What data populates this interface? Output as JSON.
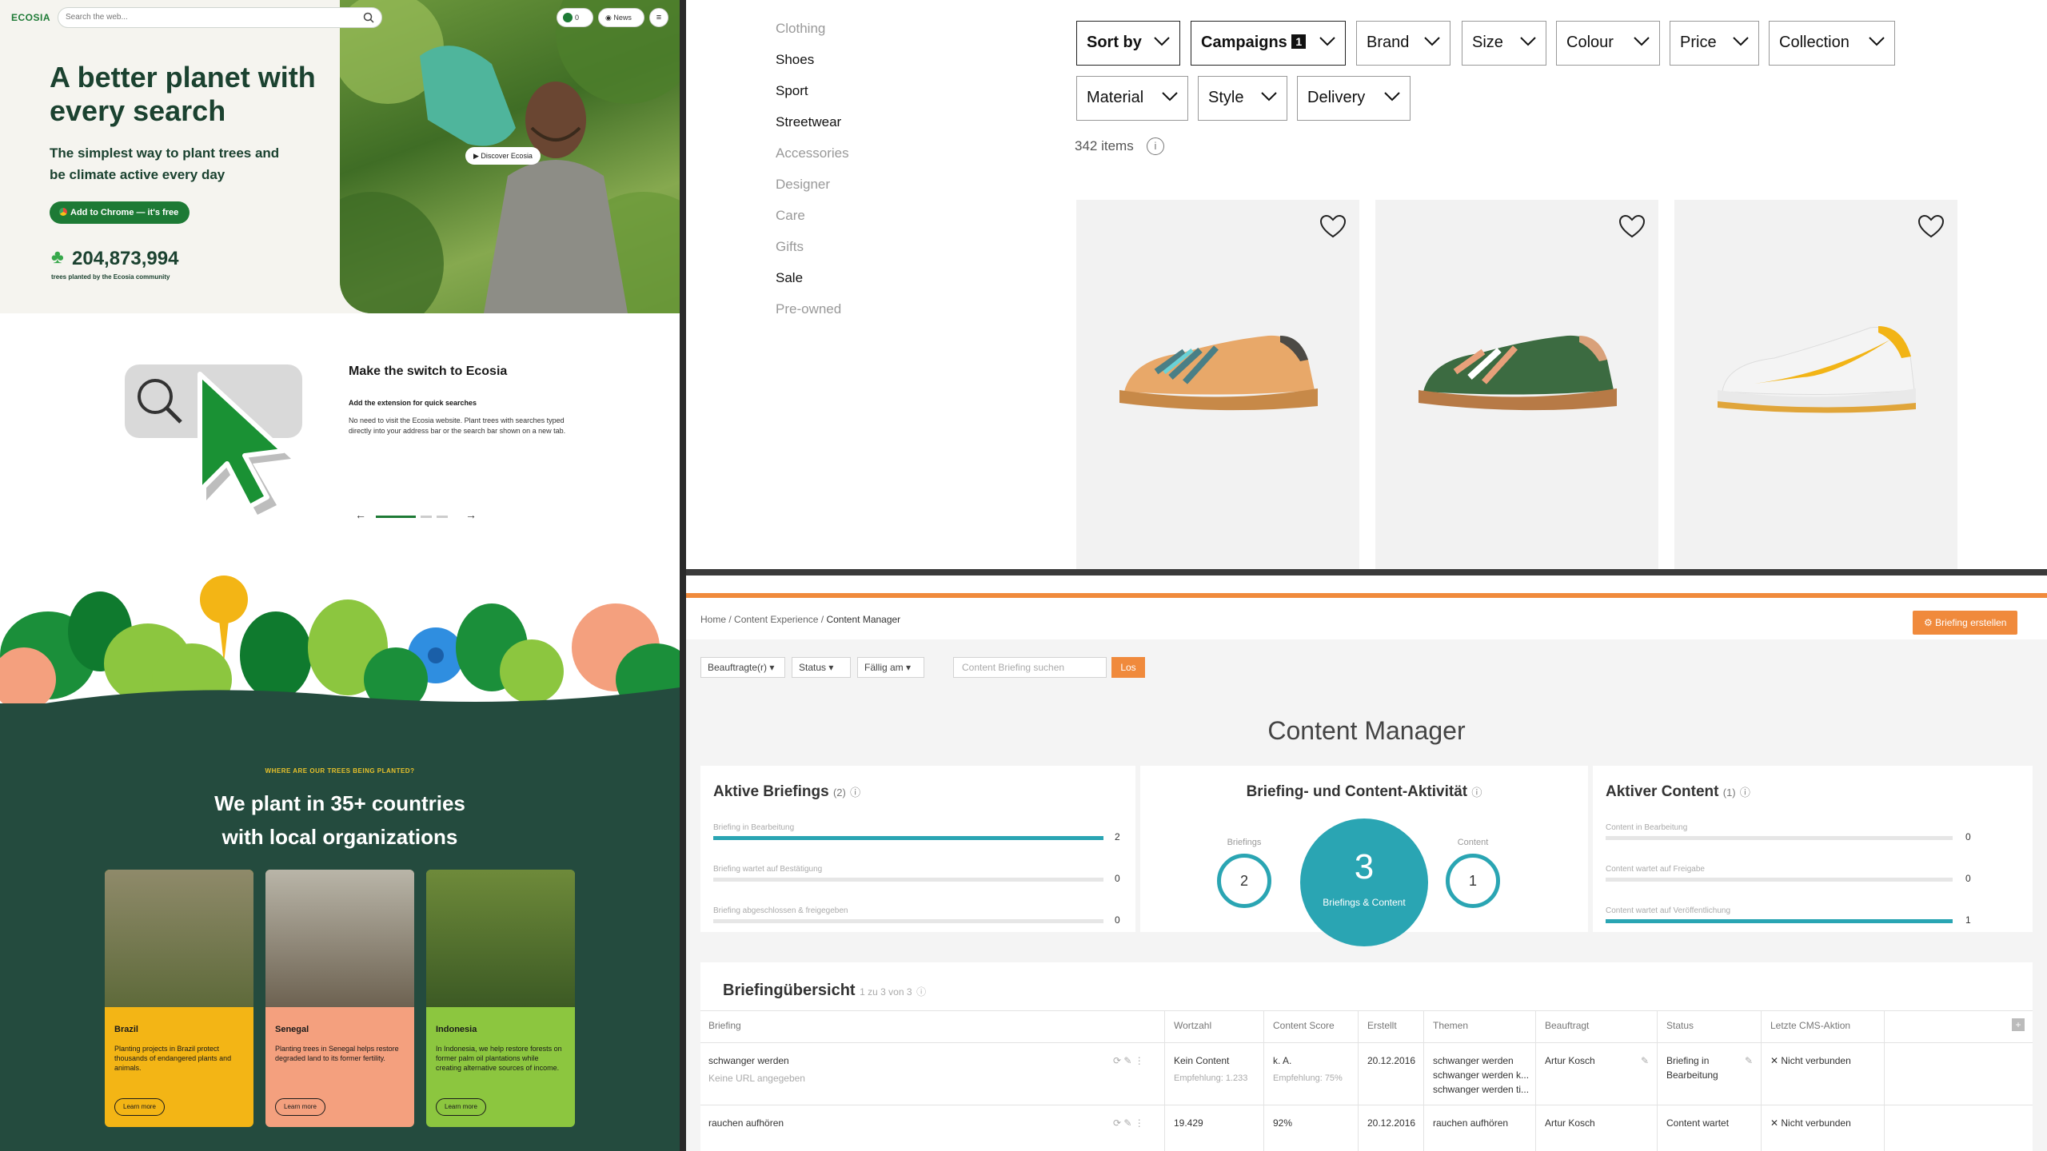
{
  "ecosia": {
    "logo": "ECOSIA",
    "search_placeholder": "Search the web...",
    "tree_counter_badge": "0",
    "news_label": "News",
    "menu_glyph": "≡",
    "headline": "A better planet with every search",
    "subheadline": "The simplest way to plant trees and be climate active every day",
    "cta_label": "Add to Chrome — it's free",
    "tree_count": "204,873,994",
    "tree_count_label": "trees planted by the Ecosia community",
    "discover_label": "▶ Discover Ecosia",
    "switch_title": "Make the switch to Ecosia",
    "switch_subtitle": "Add the extension for quick searches",
    "switch_body": "No need to visit the Ecosia website. Plant trees with searches typed directly into your address bar or the search bar shown on a new tab.",
    "carousel_prev": "←",
    "carousel_next": "→",
    "where_label": "WHERE ARE OUR TREES BEING PLANTED?",
    "countries_headline_1": "We plant in 35+ countries",
    "countries_headline_2": "with local organizations",
    "cards": [
      {
        "name": "Brazil",
        "text": "Planting projects in Brazil protect thousands of endangered plants and animals.",
        "button": "Learn more",
        "color": "#f3b515"
      },
      {
        "name": "Senegal",
        "text": "Planting trees in Senegal helps restore degraded land to its former fertility.",
        "button": "Learn more",
        "color": "#f4a07e"
      },
      {
        "name": "Indonesia",
        "text": "In Indonesia, we help restore forests on former palm oil plantations while creating alternative sources of income.",
        "button": "Learn more",
        "color": "#8cc63f"
      }
    ],
    "colors": {
      "brand_green": "#1d7a35",
      "dark_green": "#244b3e",
      "headline": "#1b4230"
    }
  },
  "shop": {
    "categories": [
      {
        "label": "Clothing",
        "active": false
      },
      {
        "label": "Shoes",
        "active": true
      },
      {
        "label": "Sport",
        "active": true
      },
      {
        "label": "Streetwear",
        "active": true
      },
      {
        "label": "Accessories",
        "active": false
      },
      {
        "label": "Designer",
        "active": false
      },
      {
        "label": "Care",
        "active": false
      },
      {
        "label": "Gifts",
        "active": false
      },
      {
        "label": "Sale",
        "active": true
      },
      {
        "label": "Pre-owned",
        "active": false
      }
    ],
    "filters": {
      "sort": "Sort by",
      "campaigns": "Campaigns",
      "campaigns_count": "1",
      "brand": "Brand",
      "size": "Size",
      "colour": "Colour",
      "price": "Price",
      "collection": "Collection",
      "material": "Material",
      "style": "Style",
      "delivery": "Delivery"
    },
    "item_count": "342 items",
    "info_glyph": "i",
    "products": [
      {
        "icon": "sneaker-orange-image"
      },
      {
        "icon": "sneaker-green-image"
      },
      {
        "icon": "sneaker-white-yellow-image"
      }
    ]
  },
  "cms": {
    "breadcrumb": [
      "Home",
      "Content Experience",
      "Content Manager"
    ],
    "new_briefing": "Briefing erstellen",
    "filter_assignee": "Beauftragte(r)",
    "filter_status": "Status",
    "filter_due": "Fällig am",
    "search_placeholder": "Content Briefing suchen",
    "search_button": "Los",
    "title": "Content Manager",
    "active_briefings": {
      "title": "Aktive Briefings",
      "count": "(2)",
      "bars": [
        {
          "label": "Briefing in Bearbeitung",
          "value": 2,
          "fill": 1.0
        },
        {
          "label": "Briefing wartet auf Bestätigung",
          "value": 0,
          "fill": 0
        },
        {
          "label": "Briefing abgeschlossen & freigegeben",
          "value": 0,
          "fill": 0
        }
      ]
    },
    "activity": {
      "title": "Briefing- und Content-Aktivität",
      "briefings_label": "Briefings",
      "briefings_value": "2",
      "total_value": "3",
      "total_label": "Briefings & Content",
      "content_label": "Content",
      "content_value": "1"
    },
    "active_content": {
      "title": "Aktiver Content",
      "count": "(1)",
      "bars": [
        {
          "label": "Content in Bearbeitung",
          "value": 0,
          "fill": 0
        },
        {
          "label": "Content wartet auf Freigabe",
          "value": 0,
          "fill": 0
        },
        {
          "label": "Content wartet auf Veröffentlichung",
          "value": 1,
          "fill": 1.0
        }
      ]
    },
    "overview": {
      "title": "Briefingübersicht",
      "subtitle": "1 zu 3 von 3",
      "columns": [
        "Briefing",
        "Wortzahl",
        "Content Score",
        "Erstellt",
        "Themen",
        "Beauftragt",
        "Status",
        "Letzte CMS-Aktion"
      ],
      "rows": [
        {
          "briefing": "schwanger werden",
          "url": "Keine URL angegeben",
          "words": "Kein Content",
          "words_hint": "Empfehlung: 1.233",
          "score": "k. A.",
          "score_hint": "Empfehlung: 75%",
          "created": "20.12.2016",
          "topics": [
            "schwanger werden",
            "schwanger werden k...",
            "schwanger werden ti..."
          ],
          "assignee": "Artur Kosch",
          "status": [
            "Briefing in",
            "Bearbeitung"
          ],
          "cms": "Nicht verbunden"
        },
        {
          "briefing": "rauchen aufhören",
          "url": "",
          "words": "19.429",
          "words_hint": "",
          "score": "92%",
          "score_hint": "",
          "created": "20.12.2016",
          "topics": [
            "rauchen aufhören"
          ],
          "assignee": "Artur Kosch",
          "status": [
            "Content wartet"
          ],
          "cms": "Nicht verbunden"
        }
      ]
    },
    "accent": "#f08a3c",
    "teal": "#2aa5b3"
  }
}
